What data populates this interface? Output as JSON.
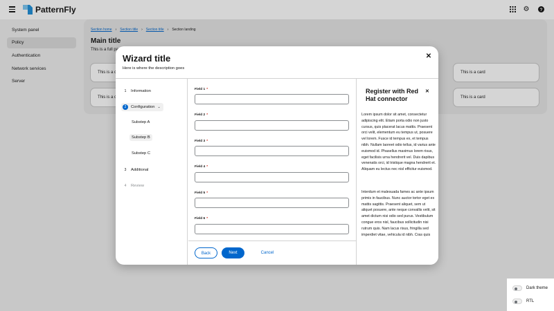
{
  "header": {
    "brand": "PatternFly",
    "icons": [
      "hamburger-icon",
      "grid-icon",
      "gear-icon",
      "help-icon"
    ]
  },
  "sidebar": {
    "items": [
      {
        "label": "System panel",
        "active": false
      },
      {
        "label": "Policy",
        "active": true
      },
      {
        "label": "Authentication",
        "active": false
      },
      {
        "label": "Network services",
        "active": false
      },
      {
        "label": "Server",
        "active": false
      }
    ]
  },
  "main": {
    "breadcrumb": [
      "Section home",
      "Section title",
      "Section title",
      "Section landing"
    ],
    "title": "Main title",
    "description": "This is a full page",
    "card_text": "This is a card"
  },
  "wizard": {
    "title": "Wizard title",
    "description": "Here is where the description goes",
    "steps": [
      {
        "num": "1",
        "label": "Information"
      },
      {
        "num": "2",
        "label": "Configuration"
      },
      {
        "num": "3",
        "label": "Additional"
      },
      {
        "num": "4",
        "label": "Review"
      }
    ],
    "substeps": [
      "Substep A",
      "Substep B",
      "Substep C"
    ],
    "fields": [
      "Field 1",
      "Field 2",
      "Field 3",
      "Field 4",
      "Field 5",
      "Field 6"
    ],
    "required_mark": "*",
    "buttons": {
      "back": "Back",
      "next": "Next",
      "cancel": "Cancel"
    }
  },
  "drawer": {
    "title": "Register with Red Hat connector",
    "paragraph1": "Lorem ipsum dolor sit amet, consectetur adipiscing elit. Etiam porta odio non justo cursus, quis placerat lacus mattis. Praesent orci velit, elementum eu tempus ut, posuere vel lorem. Fusce id tempus ex, et tempus nibh. Nullam laoreet odio tellus, id varius ante euismod id. Phasellus maximus lorem risus, eget facilisis urna hendrerit vel. Duis dapibus venenatis orci, id tristique magna hendrerit et. Aliquam eu lectus nec nisl efficitur euismod.",
    "paragraph2": "Interdum et malesuada fames ac ante ipsum primis in faucibus. Nunc auctor tortor eget ex mattis sagittis. Praesent aliquet, sem ut aliquet posuere, ante neque convallis velit, sit amet dictum nisi odio sed purus. Vestibulum congue eros nisl, faucibus sollicitudin nisi rutrum quis. Nam lacus risus, fringilla sed imperdiet vitae, vehicula id nibh. Cras quis"
  },
  "theme": {
    "dark_label": "Dark theme",
    "rtl_label": "RTL"
  },
  "colors": {
    "accent": "#0066cc",
    "required": "#c9190b"
  }
}
